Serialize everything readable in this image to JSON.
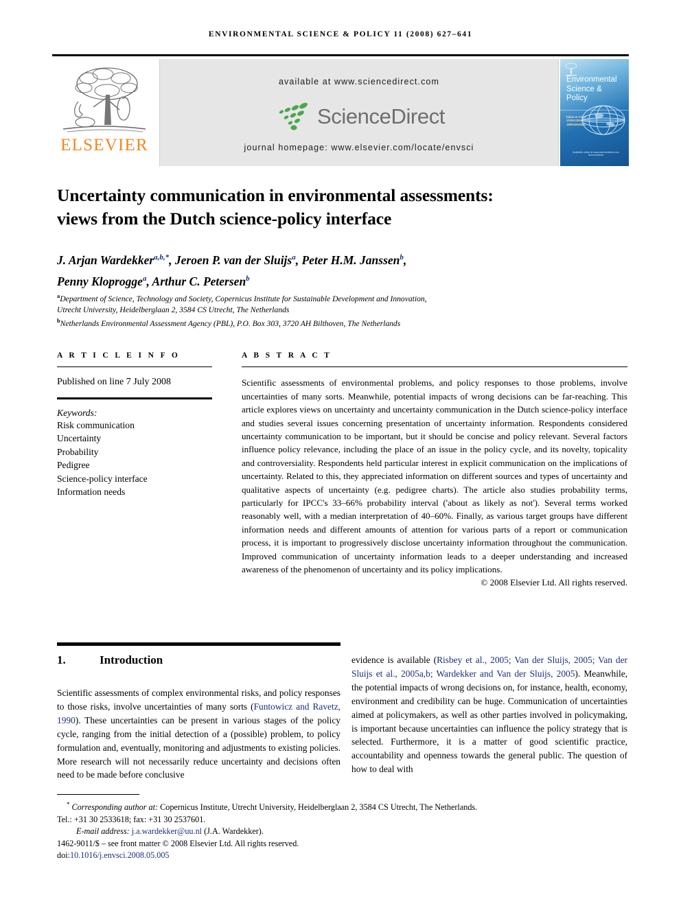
{
  "running_head": "Environmental Science & Policy 11 (2008) 627–641",
  "masthead": {
    "elsevier_wordmark": "ELSEVIER",
    "available_at": "available at www.sciencedirect.com",
    "sciencedirect_wordmark": "ScienceDirect",
    "journal_homepage": "journal homepage: www.elsevier.com/locate/envsci",
    "cover": {
      "title": "Environmental Science & Policy",
      "editor_label": "Editor-in-Chief",
      "editor_name": "SVEN ERIK JØRGENSEN",
      "footer": "Available online at www.sciencedirect.com ScienceDirect"
    },
    "colors": {
      "elsevier_orange": "#F5861F",
      "sciencedirect_green": "#4CA64C",
      "sciencedirect_gray": "#6E6E6E",
      "banner_background": "#E6E6E6",
      "cover_blue": "#2272B4",
      "citation_blue": "#1A2F7A"
    }
  },
  "article": {
    "title_line1": "Uncertainty communication in environmental assessments:",
    "title_line2": "views from the Dutch science-policy interface",
    "authors_line1_parts": [
      {
        "name": "J. Arjan Wardekker",
        "sup": "a,b,*"
      },
      {
        "name": "Jeroen P. van der Sluijs",
        "sup": "a"
      },
      {
        "name": "Peter H.M. Janssen",
        "sup": "b"
      }
    ],
    "authors_line2_parts": [
      {
        "name": "Penny Kloprogge",
        "sup": "a"
      },
      {
        "name": "Arthur C. Petersen",
        "sup": "b"
      }
    ],
    "affiliation_a_line1": "Department of Science, Technology and Society, Copernicus Institute for Sustainable Development and Innovation,",
    "affiliation_a_line2": "Utrecht University, Heidelberglaan 2, 3584 CS Utrecht, The Netherlands",
    "affiliation_b": "Netherlands Environmental Assessment Agency (PBL), P.O. Box 303, 3720 AH Bilthoven, The Netherlands"
  },
  "article_info": {
    "heading": "A R T I C L E   I N F O",
    "published": "Published on line 7 July 2008",
    "keywords_label": "Keywords:",
    "keywords": [
      "Risk communication",
      "Uncertainty",
      "Probability",
      "Pedigree",
      "Science-policy interface",
      "Information needs"
    ]
  },
  "abstract": {
    "heading": "A B S T R A C T",
    "body": "Scientific assessments of environmental problems, and policy responses to those problems, involve uncertainties of many sorts. Meanwhile, potential impacts of wrong decisions can be far-reaching. This article explores views on uncertainty and uncertainty communication in the Dutch science-policy interface and studies several issues concerning presentation of uncertainty information. Respondents considered uncertainty communication to be important, but it should be concise and policy relevant. Several factors influence policy relevance, including the place of an issue in the policy cycle, and its novelty, topicality and controversiality. Respondents held particular interest in explicit communication on the implications of uncertainty. Related to this, they appreciated information on different sources and types of uncertainty and qualitative aspects of uncertainty (e.g. pedigree charts). The article also studies probability terms, particularly for IPCC's 33–66% probability interval ('about as likely as not'). Several terms worked reasonably well, with a median interpretation of 40–60%. Finally, as various target groups have different information needs and different amounts of attention for various parts of a report or communication process, it is important to progressively disclose uncertainty information throughout the communication. Improved communication of uncertainty information leads to a deeper understanding and increased awareness of the phenomenon of uncertainty and its policy implications.",
    "copyright": "© 2008 Elsevier Ltd. All rights reserved."
  },
  "section": {
    "number": "1.",
    "title": "Introduction",
    "left_text_part1": "Scientific assessments of complex environmental risks, and policy responses to those risks, involve uncertainties of many sorts (",
    "left_citation1": "Funtowicz and Ravetz, 1990",
    "left_text_part2": "). These uncertainties can be present in various stages of the policy cycle, ranging from the initial detection of a (possible) problem, to policy formulation and, eventually, monitoring and adjustments to existing policies. More research will not necessarily reduce uncertainty and decisions often need to be made before conclusive",
    "right_text_part1": "evidence is available (",
    "right_citation1": "Risbey et al., 2005; Van der Sluijs, 2005; Van der Sluijs et al., 2005a,b; Wardekker and Van der Sluijs, 2005",
    "right_text_part2": "). Meanwhile, the potential impacts of wrong decisions on, for instance, health, economy, environment and credibility can be huge. Communication of uncertainties aimed at policymakers, as well as other parties involved in policymaking, is important because uncertainties can influence the policy strategy that is selected. Furthermore, it is a matter of good scientific practice, accountability and openness towards the general public. The question of how to deal with"
  },
  "footnotes": {
    "corresponding_label": "Corresponding author at:",
    "corresponding_text": "Copernicus Institute, Utrecht University, Heidelberglaan 2, 3584 CS Utrecht, The Netherlands.",
    "tel_line": "Tel.: +31 30 2533618; fax: +31 30 2537601.",
    "email_label": "E-mail address:",
    "email_address": "j.a.wardekker@uu.nl",
    "email_owner": "(J.A. Wardekker).",
    "front_matter": "1462-9011/$ – see front matter © 2008 Elsevier Ltd. All rights reserved.",
    "doi_label": "doi:",
    "doi_value": "10.1016/j.envsci.2008.05.005"
  }
}
